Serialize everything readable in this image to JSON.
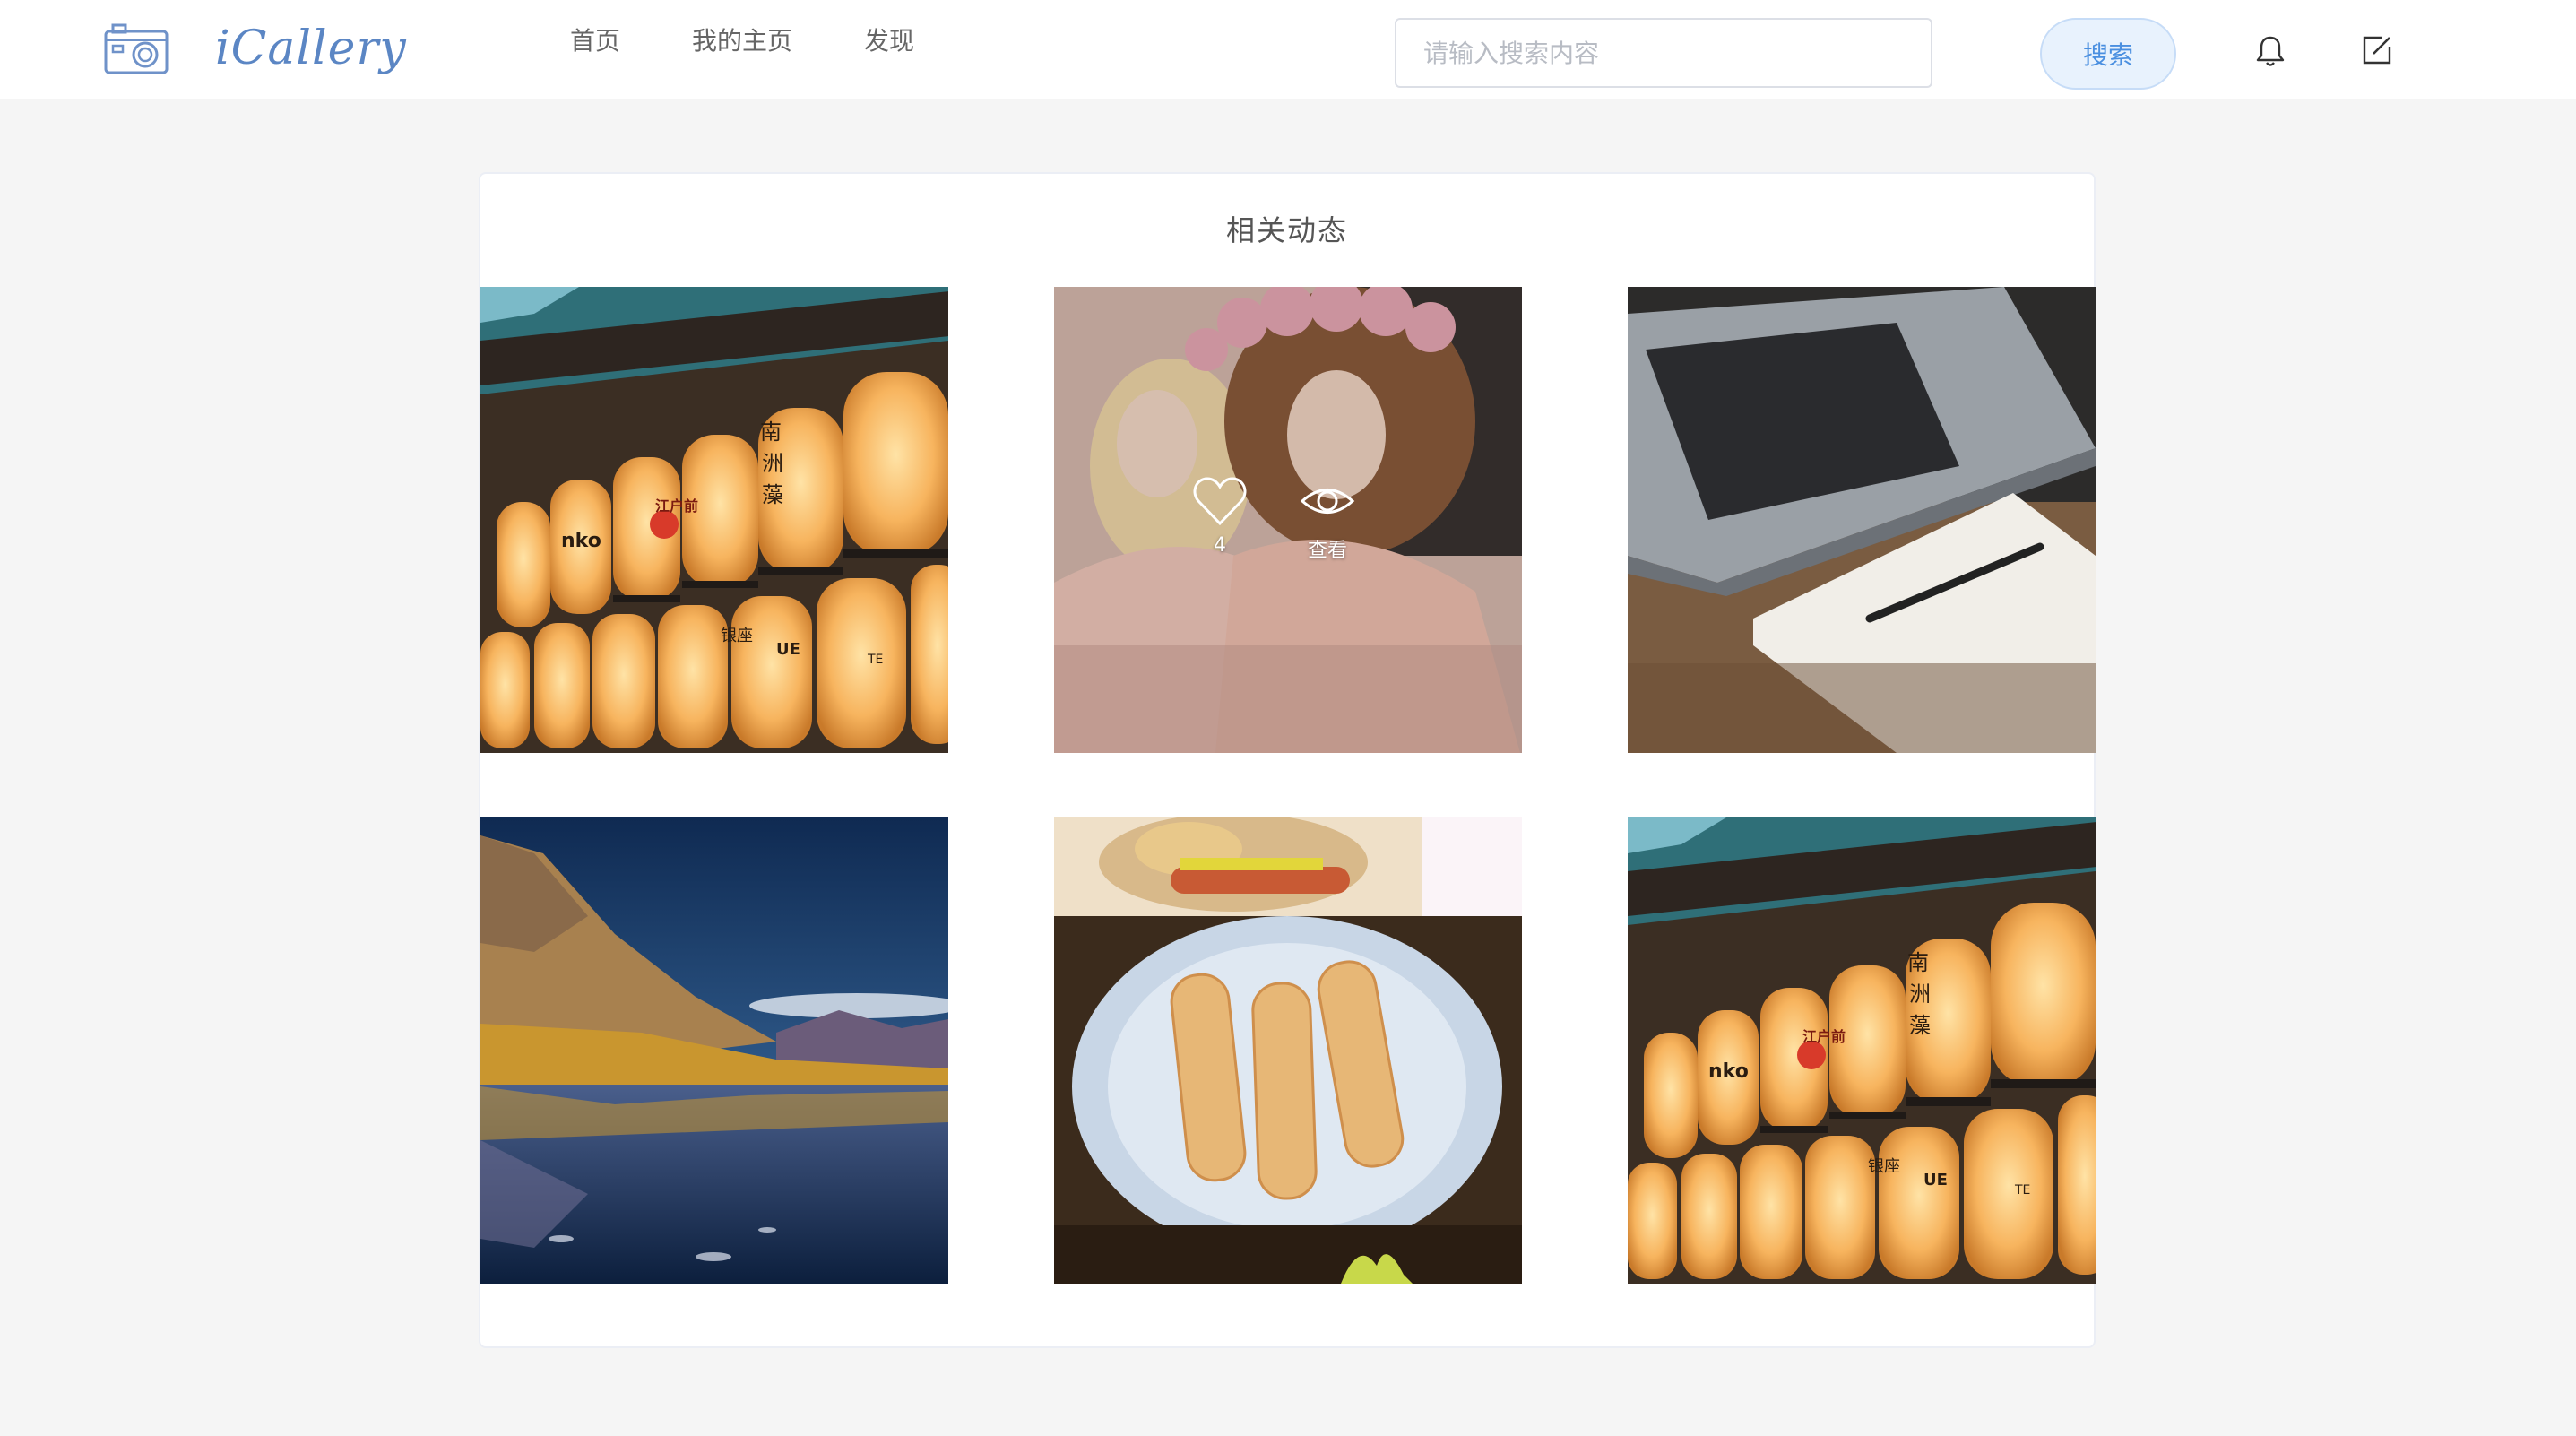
{
  "header": {
    "logo_text": "iCallery",
    "nav": [
      {
        "label": "首页"
      },
      {
        "label": "我的主页"
      },
      {
        "label": "发现"
      }
    ],
    "search": {
      "placeholder": "请输入搜索内容",
      "value": ""
    },
    "search_button_label": "搜索",
    "icons": [
      "camera-logo-icon",
      "bell-icon",
      "edit-icon"
    ]
  },
  "feed": {
    "title": "相关动态",
    "photos": [
      {
        "subject": "paper lanterns",
        "lantern_text": [
          "南",
          "洲",
          "藻",
          "江户前",
          "nko",
          "银座",
          "UE",
          "TE"
        ]
      },
      {
        "subject": "portrait with flower crown",
        "overlay": {
          "likes": "4",
          "view_label": "查看"
        }
      },
      {
        "subject": "laptop and notebook"
      },
      {
        "subject": "mountain lake reflection"
      },
      {
        "subject": "hot dogs and sausage pastries"
      },
      {
        "subject": "paper lanterns",
        "lantern_text": [
          "南",
          "洲",
          "藻",
          "江户前",
          "nko",
          "银座",
          "UE",
          "TE"
        ]
      }
    ]
  },
  "colors": {
    "page_background": "#f5f5f5",
    "brand_blue": "#5b86c4",
    "search_button_bg": "#e8f2fd",
    "search_button_text": "#4a8fe0"
  }
}
